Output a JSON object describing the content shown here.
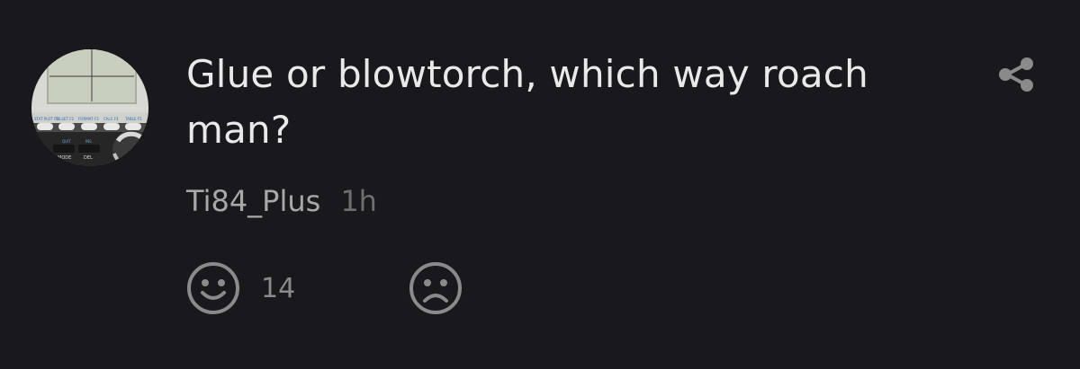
{
  "post": {
    "title": "Glue or blowtorch, which way roach man?",
    "author": "Ti84_Plus",
    "time": "1h"
  },
  "avatar": {
    "keys": [
      "STAT PLOT F1",
      "TBLSET F2",
      "FORMAT F3",
      "CALC F4",
      "TABLE F5"
    ],
    "mode_label": "MODE",
    "del_label": "DEL",
    "quit_label": "QUIT",
    "ins_label": "INS"
  },
  "reactions": {
    "like": {
      "icon": "smile-icon",
      "count": "14"
    },
    "dislike": {
      "icon": "frown-icon",
      "count": ""
    }
  },
  "icons": {
    "share": "share-icon"
  },
  "colors": {
    "background": "#18181d",
    "title": "#e9e9e9",
    "author": "#a8a8a8",
    "time": "#6e6e6e",
    "icon": "#8a8a8a"
  }
}
